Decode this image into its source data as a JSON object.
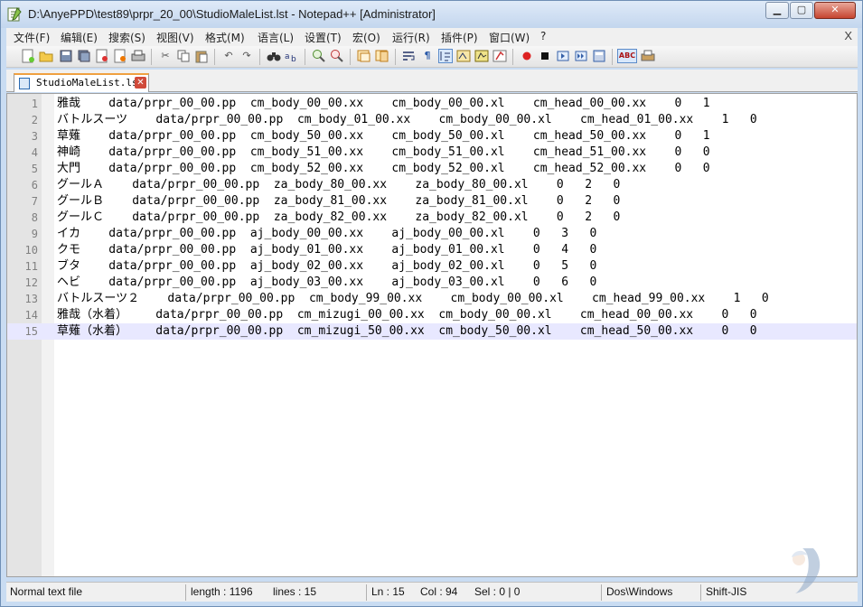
{
  "window": {
    "title": "D:\\AnyePPD\\test89\\prpr_20_00\\StudioMaleList.lst - Notepad++ [Administrator]"
  },
  "menu": [
    "文件(F)",
    "编辑(E)",
    "搜索(S)",
    "视图(V)",
    "格式(M)",
    "语言(L)",
    "设置(T)",
    "宏(O)",
    "运行(R)",
    "插件(P)",
    "窗口(W)",
    "?"
  ],
  "menu_close": "X",
  "tab": {
    "label": "StudioMaleList.lst"
  },
  "lines": [
    {
      "n": "1",
      "text": "雅哉    data/prpr_00_00.pp  cm_body_00_00.xx    cm_body_00_00.xl    cm_head_00_00.xx    0   1"
    },
    {
      "n": "2",
      "text": "バトルスーツ    data/prpr_00_00.pp  cm_body_01_00.xx    cm_body_00_00.xl    cm_head_01_00.xx    1   0"
    },
    {
      "n": "3",
      "text": "草薙    data/prpr_00_00.pp  cm_body_50_00.xx    cm_body_50_00.xl    cm_head_50_00.xx    0   1"
    },
    {
      "n": "4",
      "text": "神崎    data/prpr_00_00.pp  cm_body_51_00.xx    cm_body_51_00.xl    cm_head_51_00.xx    0   0"
    },
    {
      "n": "5",
      "text": "大門    data/prpr_00_00.pp  cm_body_52_00.xx    cm_body_52_00.xl    cm_head_52_00.xx    0   0"
    },
    {
      "n": "6",
      "text": "グールＡ    data/prpr_00_00.pp  za_body_80_00.xx    za_body_80_00.xl    0   2   0"
    },
    {
      "n": "7",
      "text": "グールＢ    data/prpr_00_00.pp  za_body_81_00.xx    za_body_81_00.xl    0   2   0"
    },
    {
      "n": "8",
      "text": "グールＣ    data/prpr_00_00.pp  za_body_82_00.xx    za_body_82_00.xl    0   2   0"
    },
    {
      "n": "9",
      "text": "イカ    data/prpr_00_00.pp  aj_body_00_00.xx    aj_body_00_00.xl    0   3   0"
    },
    {
      "n": "10",
      "text": "クモ    data/prpr_00_00.pp  aj_body_01_00.xx    aj_body_01_00.xl    0   4   0"
    },
    {
      "n": "11",
      "text": "ブタ    data/prpr_00_00.pp  aj_body_02_00.xx    aj_body_02_00.xl    0   5   0"
    },
    {
      "n": "12",
      "text": "ヘビ    data/prpr_00_00.pp  aj_body_03_00.xx    aj_body_03_00.xl    0   6   0"
    },
    {
      "n": "13",
      "text": "バトルスーツ２    data/prpr_00_00.pp  cm_body_99_00.xx    cm_body_00_00.xl    cm_head_99_00.xx    1   0"
    },
    {
      "n": "14",
      "text": "雅哉（水着）    data/prpr_00_00.pp  cm_mizugi_00_00.xx  cm_body_00_00.xl    cm_head_00_00.xx    0   0"
    },
    {
      "n": "15",
      "text": "草薙（水着）    data/prpr_00_00.pp  cm_mizugi_50_00.xx  cm_body_50_00.xl    cm_head_50_00.xx    0   0"
    }
  ],
  "status": {
    "type": "Normal text file",
    "length": "length : 1196",
    "lines": "lines : 15",
    "ln": "Ln : 15",
    "col": "Col : 94",
    "sel": "Sel : 0 | 0",
    "eol": "Dos\\Windows",
    "encoding": "Shift-JIS"
  },
  "colors": {
    "current_line": "#e8e8ff",
    "gutter": "#e4e4e4",
    "title_bg": "#c9dcf2",
    "close_btn": "#c6442f"
  }
}
